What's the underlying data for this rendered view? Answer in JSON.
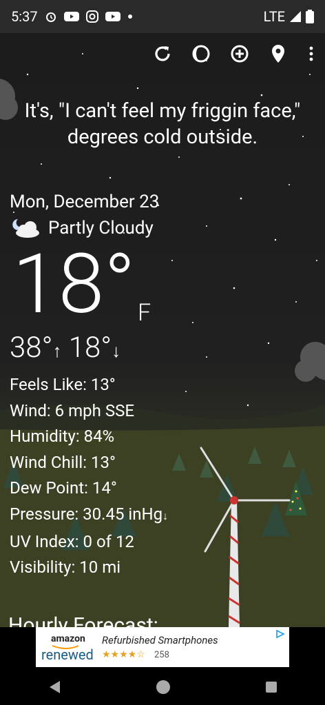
{
  "status": {
    "time": "5:37",
    "network": "LTE"
  },
  "quip": "It's, \"I can't feel my friggin face,\" degrees cold outside.",
  "date": "Mon, December 23",
  "condition": "Partly Cloudy",
  "temperature": "18°",
  "unit": "F",
  "high": "38°",
  "low": "18°",
  "details": {
    "feels_like": "Feels Like:  13°",
    "wind": "Wind:  6 mph SSE",
    "humidity": "Humidity:  84%",
    "wind_chill": "Wind Chill:  13°",
    "dew_point": "Dew Point:  14°",
    "pressure": "Pressure:  30.45 inHg",
    "uv_index": "UV Index:  0 of 12",
    "visibility": "Visibility:  10 mi"
  },
  "hourly_title": "Hourly Forecast:",
  "ad": {
    "brand_top": "amazon",
    "brand_bottom": "renewed",
    "headline": "Refurbished Smartphones",
    "rating_count": "258",
    "stars": 4
  }
}
